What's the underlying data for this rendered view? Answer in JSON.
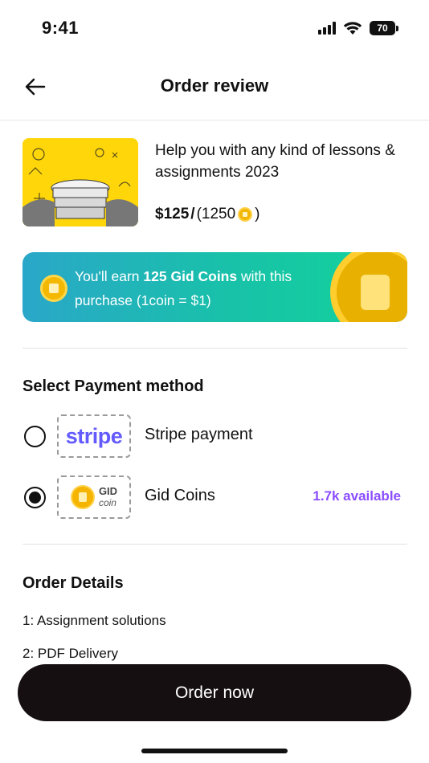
{
  "status_bar": {
    "time": "9:41",
    "battery": "70"
  },
  "header": {
    "title": "Order review"
  },
  "product": {
    "title": "Help you with any kind of lessons & assignments 2023",
    "price": "$125",
    "separator": " / ",
    "coin_price_open": "(1250",
    "coin_price_close": ")"
  },
  "earn_banner": {
    "prefix": "You'll earn ",
    "highlight": "125 Gid Coins",
    "suffix": " with this purchase (1coin = $1)"
  },
  "payment": {
    "section_title": "Select Payment method",
    "options": [
      {
        "logo_text": "stripe",
        "label": "Stripe payment",
        "selected": false
      },
      {
        "logo_top": "GID",
        "logo_bottom": "coin",
        "label": "Gid Coins",
        "available": "1.7k available",
        "selected": true
      }
    ]
  },
  "order_details": {
    "title": "Order Details",
    "items": [
      "1: Assignment solutions",
      "2: PDF Delivery"
    ]
  },
  "cta": {
    "label": "Order now"
  },
  "colors": {
    "accent_purple": "#8a4dff",
    "stripe": "#635bff",
    "button_bg": "#150f12",
    "banner_start": "#2aa7c9",
    "banner_end": "#12d49a"
  }
}
